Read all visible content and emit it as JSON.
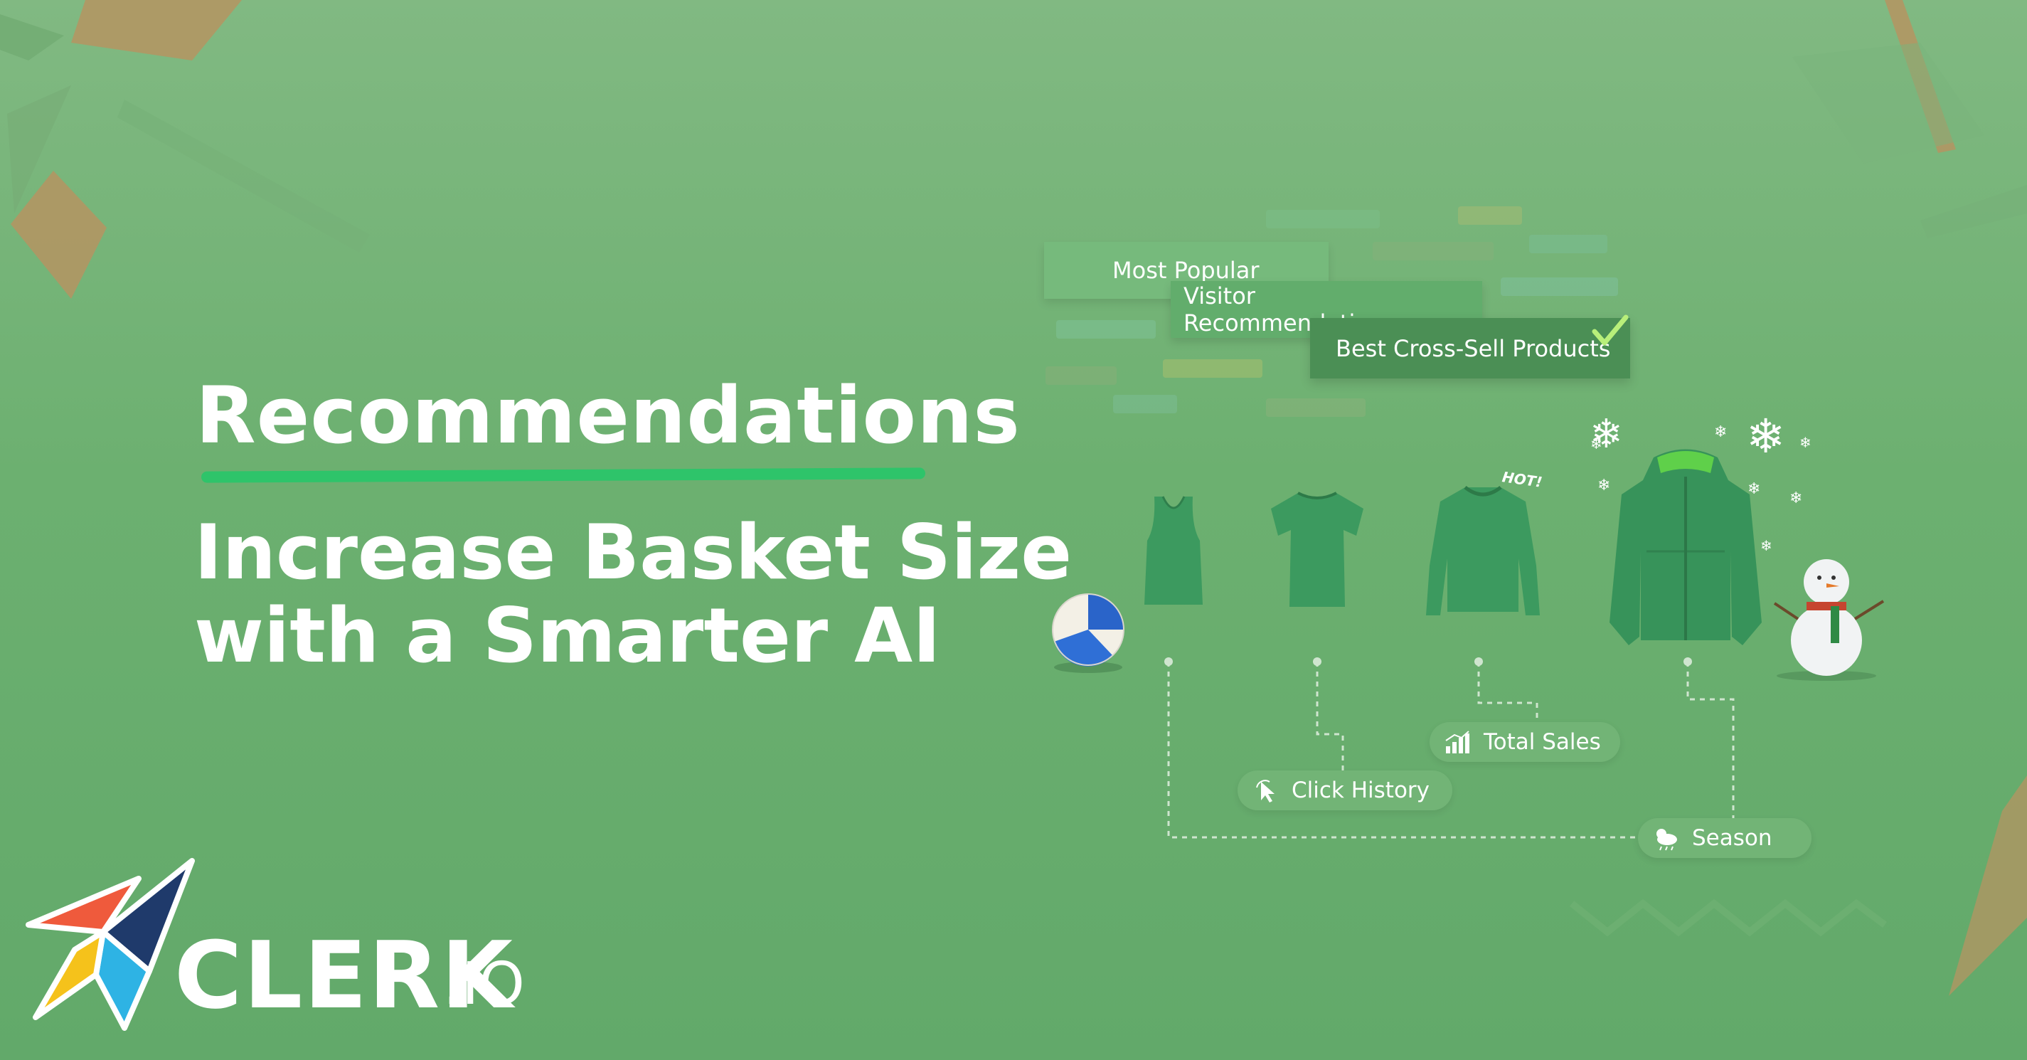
{
  "heading": {
    "title": "Recommendations",
    "subtitle_line1": "Increase Basket Size",
    "subtitle_line2": "with a Smarter AI"
  },
  "recommendation_tags": [
    "Most Popular",
    "Visitor Recommendations",
    "Best Cross-Sell Products"
  ],
  "hot_label": "HOT!",
  "data_sources": {
    "total_sales": "Total Sales",
    "click_history": "Click History",
    "season": "Season"
  },
  "logo": {
    "name": "CLERK",
    "suffix": ".IO"
  },
  "colors": {
    "background": "#6cb070",
    "accent_underline": "#2ec46a",
    "product_green": "#3c9a5f",
    "text": "#ffffff"
  }
}
